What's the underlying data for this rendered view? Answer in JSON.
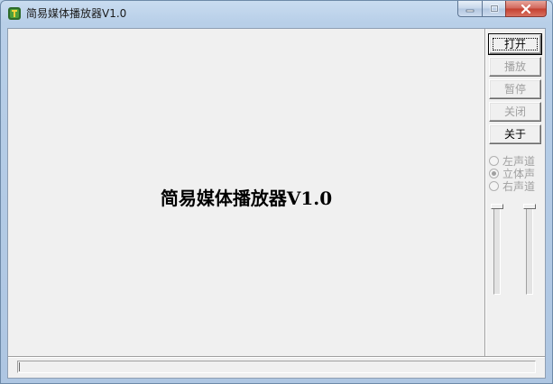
{
  "window": {
    "title": "简易媒体播放器V1.0"
  },
  "main": {
    "display_title": "简易媒体播放器V1.0"
  },
  "controls": {
    "buttons": [
      {
        "label": "打开",
        "enabled": true
      },
      {
        "label": "播放",
        "enabled": false
      },
      {
        "label": "暂停",
        "enabled": false
      },
      {
        "label": "关闭",
        "enabled": false
      },
      {
        "label": "关于",
        "enabled": true
      }
    ],
    "channels": [
      {
        "label": "左声道",
        "checked": false,
        "enabled": false
      },
      {
        "label": "立体声",
        "checked": true,
        "enabled": false
      },
      {
        "label": "右声道",
        "checked": false,
        "enabled": false
      }
    ]
  },
  "sliders": {
    "left_value": 0,
    "right_value": 0
  },
  "progress": {
    "value": 0
  },
  "icons": {
    "app": "media-player-icon",
    "minimize": "minimize-icon",
    "maximize": "maximize-icon",
    "close": "close-icon"
  }
}
